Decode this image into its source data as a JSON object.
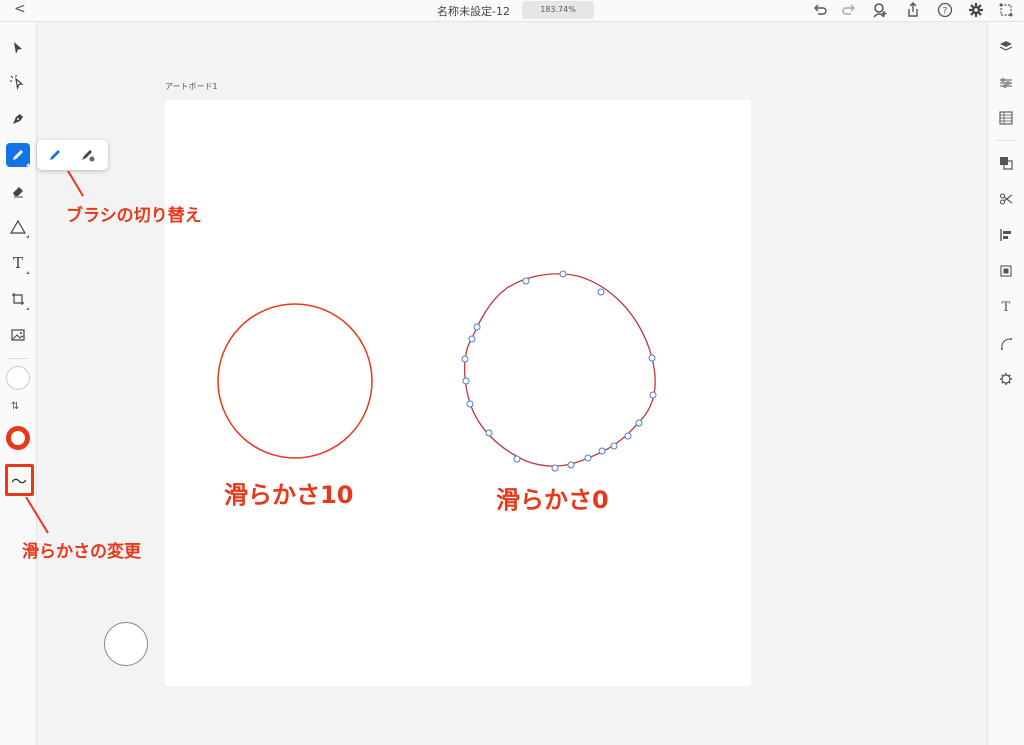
{
  "topbar": {
    "back_icon": "<",
    "doc_title": "名称未設定-12",
    "zoom": "183.74%",
    "icons": [
      "undo-icon",
      "redo-icon",
      "share-user-icon",
      "export-icon",
      "help-icon",
      "settings-icon",
      "plugins-icon"
    ]
  },
  "left_tools": [
    "select-icon",
    "direct-select-icon",
    "pen-icon",
    "pencil-icon",
    "eraser-icon",
    "shape-icon",
    "text-icon",
    "crop-icon",
    "image-icon"
  ],
  "right_tools": [
    "layers-icon",
    "properties-icon",
    "libraries-icon",
    "arrange-icon",
    "path-ops-icon",
    "align-icon",
    "transform-icon",
    "type-icon",
    "path-icon",
    "settings-icon"
  ],
  "artboard": {
    "label": "アートボード1"
  },
  "annotations": {
    "brush_switch": "ブラシの切り替え",
    "smooth_change": "滑らかさの変更",
    "smooth10": "滑らかさ10",
    "smooth0": "滑らかさ0"
  },
  "colors": {
    "accent": "#1473e6",
    "annotation": "#e8381b",
    "path_blue": "#4a7fd4"
  }
}
